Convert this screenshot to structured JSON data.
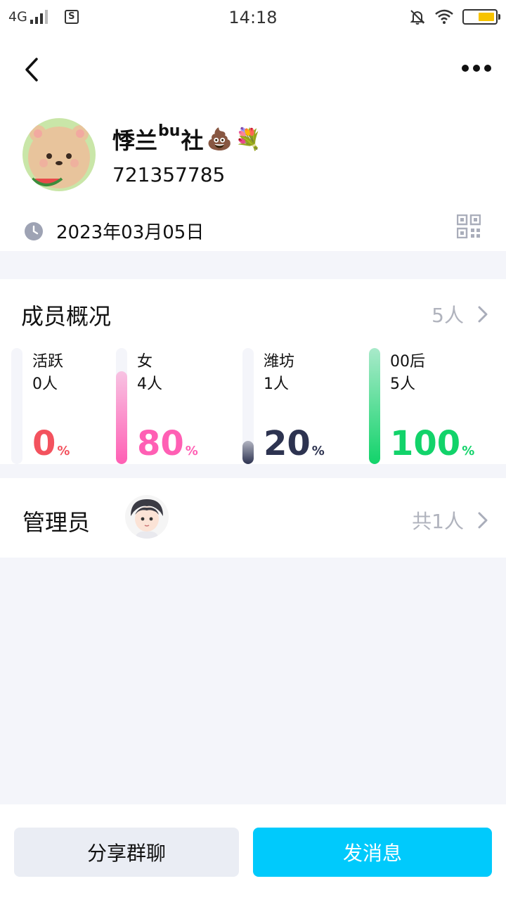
{
  "status_bar": {
    "network": "4G",
    "time": "14:18",
    "app_icon_letter": "S",
    "colors": {
      "battery": "#f7c300"
    }
  },
  "header": {
    "back_icon": "chevron-left-icon",
    "more_icon": "more-dots-icon"
  },
  "group": {
    "name_main": "悸兰",
    "name_sup": "bu",
    "name_tail": "社",
    "name_emoji_1": "💩",
    "name_emoji_2": "💐",
    "id": "721357785",
    "created_date": "2023年03月05日",
    "qr_icon": "qr-code-icon"
  },
  "members": {
    "title": "成员概况",
    "count_label": "5人",
    "stats": [
      {
        "label": "活跃",
        "count": "0人",
        "percent": "0",
        "percent_sign": "%",
        "fraction": 0.0,
        "color": "#f3525e"
      },
      {
        "label": "女",
        "count": "4人",
        "percent": "80",
        "percent_sign": "%",
        "fraction": 0.8,
        "color": "#ff5fb4"
      },
      {
        "label": "潍坊",
        "count": "1人",
        "percent": "20",
        "percent_sign": "%",
        "fraction": 0.2,
        "color": "#2d3350"
      },
      {
        "label": "00后",
        "count": "5人",
        "percent": "100",
        "percent_sign": "%",
        "fraction": 1.0,
        "color": "#12d36a"
      }
    ]
  },
  "admins": {
    "title": "管理员",
    "count_label": "共1人"
  },
  "actions": {
    "share_label": "分享群聊",
    "send_label": "发消息",
    "colors": {
      "primary": "#00cafc",
      "secondary": "#eaedf4"
    }
  }
}
